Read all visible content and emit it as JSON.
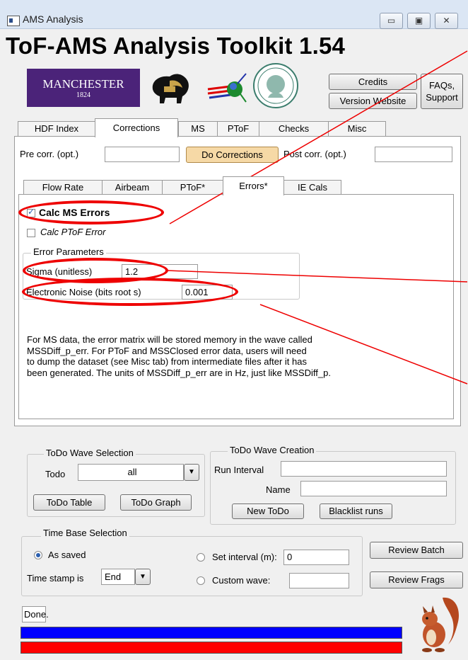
{
  "window": {
    "title": "AMS Analysis",
    "min_glyph": "▭",
    "max_glyph": "▣",
    "close_glyph": "✕"
  },
  "header": {
    "app_title": "ToF-AMS Analysis Toolkit 1.54",
    "logo_manchester": "MANCHESTER",
    "logo_year": "1824",
    "credits": "Credits",
    "version_website": "Version Website",
    "faqs": "FAQs,",
    "support": "Support"
  },
  "main_tabs": [
    "HDF Index",
    "Corrections",
    "MS",
    "PToF",
    "Checks",
    "Misc"
  ],
  "corrections": {
    "pre_label": "Pre corr. (opt.)",
    "pre_value": "",
    "do_button": "Do Corrections",
    "post_label": "Post corr. (opt.)",
    "post_value": ""
  },
  "sub_tabs": [
    "Flow Rate",
    "Airbeam",
    "PToF*",
    "Errors*",
    "IE Cals"
  ],
  "errors": {
    "calc_ms_label": "Calc MS Errors",
    "calc_ms_checked": true,
    "calc_ptof_label": "Calc PToF Error",
    "calc_ptof_checked": false,
    "group_title": "Error Parameters",
    "sigma_label": "Sigma (unitless)",
    "sigma_value": "1.2",
    "noise_label": "Electronic Noise (bits root s)",
    "noise_value": "0.001",
    "info_lines": [
      "For MS data, the error matrix will be stored memory in the wave called",
      "MSSDiff_p_err. For PToF and MSSClosed error data, users will need",
      "to dump the dataset (see Misc tab) from intermediate files after it has",
      "been generated. The units of MSSDiff_p_err are in Hz, just like MSSDiff_p."
    ]
  },
  "todo_selection": {
    "title": "ToDo Wave Selection",
    "todo_label": "Todo",
    "todo_value": "all",
    "table_button": "ToDo Table",
    "graph_button": "ToDo Graph"
  },
  "todo_creation": {
    "title": "ToDo Wave Creation",
    "run_interval_label": "Run Interval",
    "run_interval_value": "",
    "name_label": "Name",
    "name_value": "",
    "new_button": "New ToDo",
    "blacklist_button": "Blacklist runs"
  },
  "time_base": {
    "title": "Time Base Selection",
    "as_saved": "As saved",
    "as_saved_selected": true,
    "timestamp_label": "Time stamp is",
    "timestamp_value": "End",
    "set_interval_label": "Set interval (m):",
    "set_interval_value": "0",
    "custom_wave_label": "Custom wave:",
    "custom_wave_value": ""
  },
  "review": {
    "batch": "Review Batch",
    "frags": "Review Frags"
  },
  "status": {
    "text": "Done."
  },
  "progress": {
    "blue_fraction": 1.0,
    "red_fraction": 1.0
  },
  "colors": {
    "accent_red": "#ee0000",
    "progress_blue": "#0000ff",
    "progress_red": "#ff0000",
    "manchester_purple": "#4b2379",
    "do_button": "#f6d9a6"
  }
}
